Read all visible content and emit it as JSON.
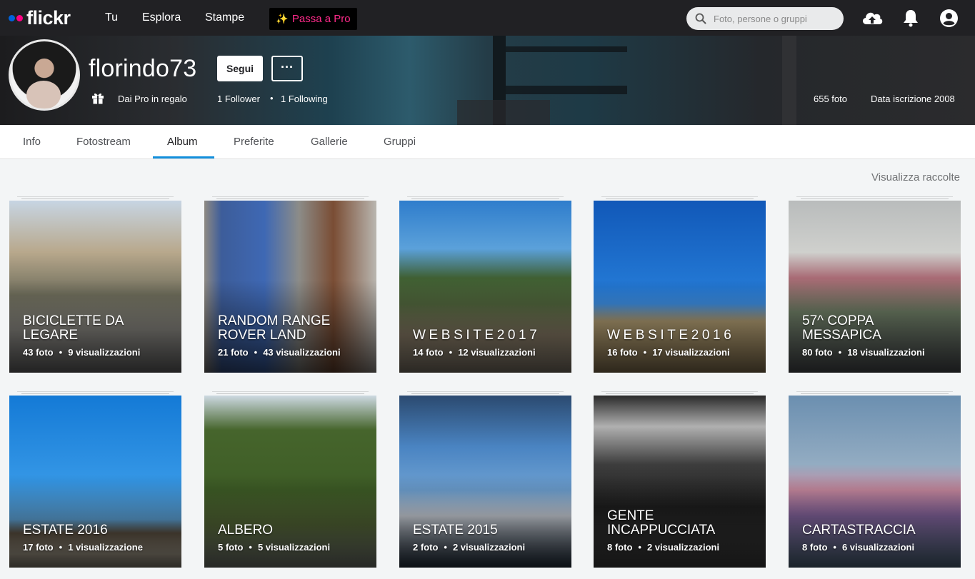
{
  "app": {
    "logo_text": "flickr",
    "brand_blue": "#0063dc",
    "brand_pink": "#ff0084"
  },
  "nav": {
    "links": [
      "Tu",
      "Esplora",
      "Stampe"
    ],
    "pro_label": "Passa a Pro",
    "search_placeholder": "Foto, persone o gruppi",
    "icons": [
      "upload-cloud-icon",
      "bell-icon",
      "user-avatar-icon"
    ]
  },
  "profile": {
    "username": "florindo73",
    "follow_label": "Segui",
    "more_label": "···",
    "gift_text": "Dai Pro in regalo",
    "followers": "1 Follower",
    "following": "1 Following",
    "photos": "655 foto",
    "joined": "Data iscrizione 2008"
  },
  "tabs": {
    "items": [
      "Info",
      "Fotostream",
      "Album",
      "Preferite",
      "Gallerie",
      "Gruppi"
    ],
    "active": "Album",
    "accent": "#128fdc"
  },
  "view_collections": "Visualizza raccolte",
  "albums": [
    {
      "title": "Biciclette da legare",
      "photos": "43 foto",
      "views": "9 visualizzazioni"
    },
    {
      "title": "Random range rover land",
      "photos": "21 foto",
      "views": "43 visualizzazioni"
    },
    {
      "title": "WEBSITE2017",
      "photos": "14 foto",
      "views": "12 visualizzazioni"
    },
    {
      "title": "WEBSITE2016",
      "photos": "16 foto",
      "views": "17 visualizzazioni"
    },
    {
      "title": "57^ coppa messapica",
      "photos": "80 foto",
      "views": "18 visualizzazioni"
    },
    {
      "title": "Estate 2016",
      "photos": "17 foto",
      "views": "1 visualizzazione"
    },
    {
      "title": "Albero",
      "photos": "5 foto",
      "views": "5 visualizzazioni"
    },
    {
      "title": "Estate 2015",
      "photos": "2 foto",
      "views": "2 visualizzazioni"
    },
    {
      "title": "Gente incappucciata",
      "photos": "8 foto",
      "views": "2 visualizzazioni"
    },
    {
      "title": "Cartastraccia",
      "photos": "8 foto",
      "views": "6 visualizzazioni"
    }
  ]
}
